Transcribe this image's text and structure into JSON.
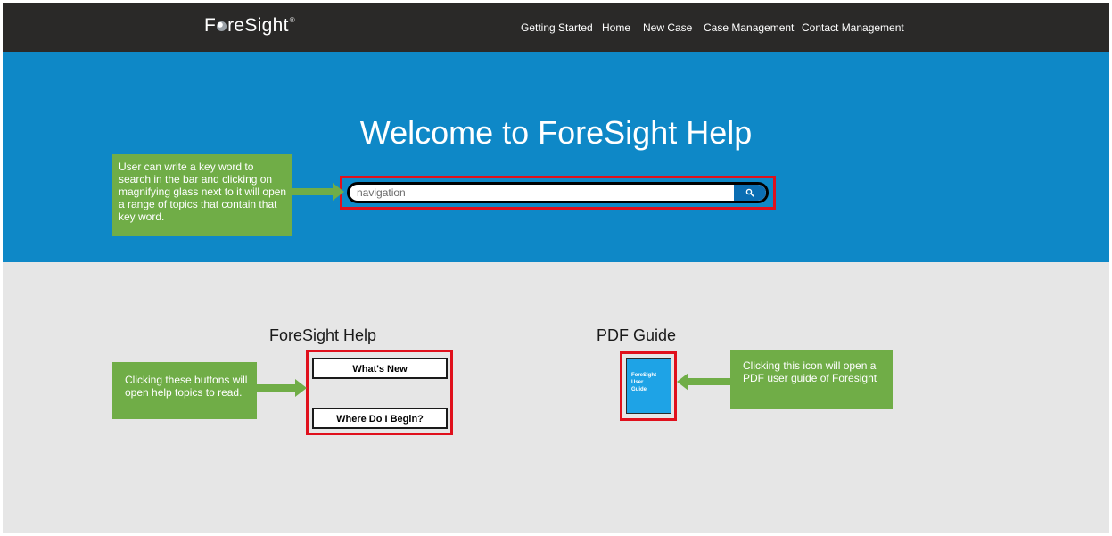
{
  "brand": {
    "name_before": "F",
    "name_after": "reSight",
    "registered": "®"
  },
  "nav": [
    {
      "label": "Getting Started"
    },
    {
      "label": "Home"
    },
    {
      "label": "New Case"
    },
    {
      "label": "Case Management"
    },
    {
      "label": "Contact Management"
    }
  ],
  "hero": {
    "title": "Welcome to ForeSight Help",
    "search": {
      "value": "navigation",
      "button_icon": "search-icon"
    }
  },
  "help_section": {
    "title": "ForeSight Help",
    "buttons": [
      {
        "label": "What's New"
      },
      {
        "label": "Where Do I Begin?"
      }
    ]
  },
  "pdf_section": {
    "title": "PDF Guide",
    "icon_lines": [
      "ForeSight",
      "User",
      "Guide"
    ]
  },
  "callouts": {
    "search": "User can write a key word to search in the bar and clicking on magnifying glass next to it will open a range of topics that contain that key word.",
    "help": "Clicking these buttons will open help topics to read.",
    "pdf": "Clicking this icon will open a PDF user guide of Foresight"
  },
  "colors": {
    "topbar": "#2a2928",
    "hero": "#0e88c7",
    "lower": "#e6e6e6",
    "callout": "#70ad47",
    "highlight": "#e0101c",
    "search_button": "#0b6eb3"
  }
}
